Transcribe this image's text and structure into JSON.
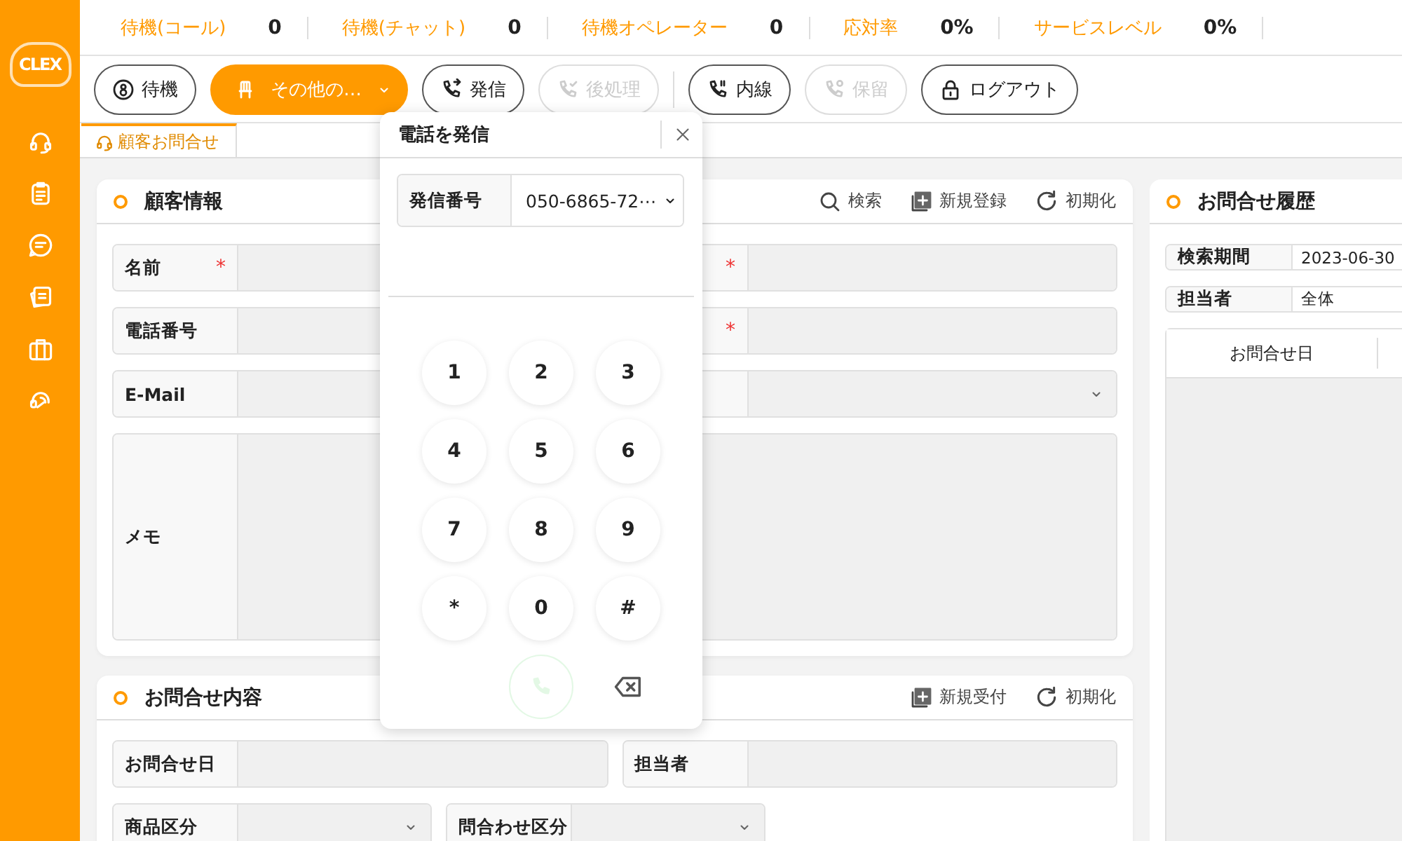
{
  "sidebar": {
    "logo": "CLEX"
  },
  "stats": [
    {
      "label": "待機(コール)",
      "value": "0"
    },
    {
      "label": "待機(チャット)",
      "value": "0"
    },
    {
      "label": "待機オペレーター",
      "value": "0"
    },
    {
      "label": "応対率",
      "value": "0%"
    },
    {
      "label": "サービスレベル",
      "value": "0%"
    }
  ],
  "toolbar": {
    "groups": [
      [
        {
          "label": "待機",
          "kind": "standby",
          "selected": false,
          "disabled": false
        },
        {
          "label": "その他の…",
          "kind": "away",
          "selected": true,
          "disabled": false
        },
        {
          "label": "発信",
          "kind": "call",
          "selected": false,
          "disabled": false
        },
        {
          "label": "後処理",
          "kind": "wrapup",
          "selected": false,
          "disabled": true
        }
      ],
      [
        {
          "label": "内線",
          "kind": "extension",
          "selected": false,
          "disabled": false
        },
        {
          "label": "保留",
          "kind": "hold",
          "selected": false,
          "disabled": true
        },
        {
          "label": "ログアウト",
          "kind": "logout",
          "selected": false,
          "disabled": false
        }
      ]
    ]
  },
  "tabs": [
    {
      "label": "顧客お問合せ",
      "selected": true
    }
  ],
  "customer": {
    "title": "顧客情報",
    "actions": [
      {
        "label": "検索",
        "kind": "search"
      },
      {
        "label": "新規登録",
        "kind": "add"
      },
      {
        "label": "初期化",
        "kind": "reset"
      }
    ],
    "rows": [
      {
        "kind": "pair",
        "left": {
          "label": "名前",
          "required": true
        },
        "right": {
          "required": true,
          "kind": "input"
        }
      },
      {
        "kind": "pair",
        "left": {
          "label": "電話番号",
          "required": false
        },
        "right": {
          "required": true,
          "kind": "input"
        }
      },
      {
        "kind": "pair",
        "left": {
          "label": "E-Mail",
          "required": false
        },
        "right": {
          "required": false,
          "kind": "select"
        }
      },
      {
        "kind": "memo",
        "label": "メモ"
      }
    ]
  },
  "inquiry": {
    "title": "お問合せ内容",
    "actions": [
      {
        "label": "新規受付",
        "kind": "add"
      },
      {
        "label": "初期化",
        "kind": "reset"
      }
    ],
    "rows": [
      {
        "kind": "wide",
        "fields": [
          {
            "label": "お問合せ日",
            "kind": "input"
          },
          {
            "label": "担当者",
            "kind": "input"
          }
        ]
      },
      {
        "kind": "compact",
        "fields": [
          {
            "label": "商品区分",
            "kind": "select"
          },
          {
            "label": "問合わせ区分",
            "kind": "select"
          }
        ]
      }
    ]
  },
  "history": {
    "title": "お問合せ履歴",
    "fields": [
      {
        "label": "検索期間",
        "value": "2023-06-30"
      },
      {
        "label": "担当者",
        "value": "全体"
      }
    ],
    "table": {
      "columns": [
        "お問合せ日"
      ]
    }
  },
  "dialer": {
    "title": "電話を発信",
    "field": {
      "label": "発信番号",
      "value": "050-6865-72⋯"
    },
    "keys": [
      "1",
      "2",
      "3",
      "4",
      "5",
      "6",
      "7",
      "8",
      "9",
      "*",
      "0",
      "#"
    ],
    "call_disabled": true
  }
}
